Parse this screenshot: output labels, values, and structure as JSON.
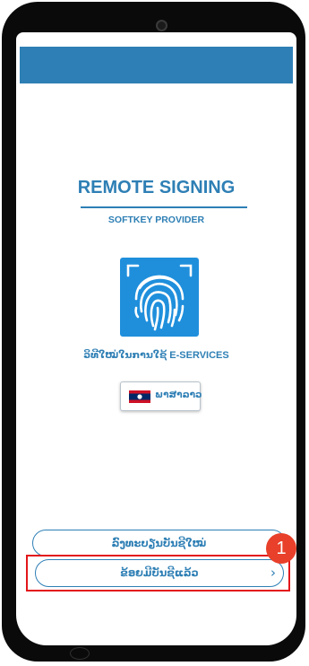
{
  "app": {
    "title": "REMOTE SIGNING",
    "subtitle": "SOFTKEY PROVIDER",
    "tagline": "ວິທີໃໝ່ໃນການໃຊ້ E-SERVICES"
  },
  "language": {
    "label": "ພາສາລາວ",
    "flag_icon": "laos-flag-icon"
  },
  "actions": {
    "register_label": "ລົງທະບຽນບັນຊີໃໝ່",
    "login_label": "ຂ້ອຍມີບັນຊີແລ້ວ",
    "login_chevron": "›"
  },
  "annotation": {
    "step_number": "1"
  },
  "colors": {
    "brand": "#2e7fb5",
    "tile": "#1f8fdc",
    "highlight": "#e3161b",
    "badge": "#e8402a"
  },
  "icons": {
    "fingerprint": "fingerprint-icon",
    "chevron": "chevron-right-icon"
  }
}
